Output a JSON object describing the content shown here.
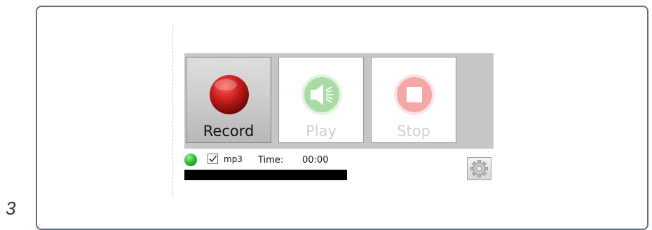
{
  "step": {
    "number": "3"
  },
  "recorder": {
    "buttons": [
      {
        "id": "record",
        "label": "Record",
        "enabled": true,
        "icon": "record-icon"
      },
      {
        "id": "play",
        "label": "Play",
        "enabled": false,
        "icon": "speaker-icon"
      },
      {
        "id": "stop",
        "label": "Stop",
        "enabled": false,
        "icon": "stop-icon"
      }
    ],
    "status": {
      "indicator": "green-status-light",
      "format_label": "mp3",
      "format_checked": true,
      "time_label": "Time:",
      "time_value": "00:00"
    },
    "progress": {
      "fraction": 0
    },
    "settings_icon": "gear-icon"
  },
  "colors": {
    "record_red": "#b71414",
    "disabled_green": "#8fd48a",
    "disabled_red": "#f0a0a0",
    "progress_track": "#000000",
    "panel_border": "#5b6f80"
  }
}
